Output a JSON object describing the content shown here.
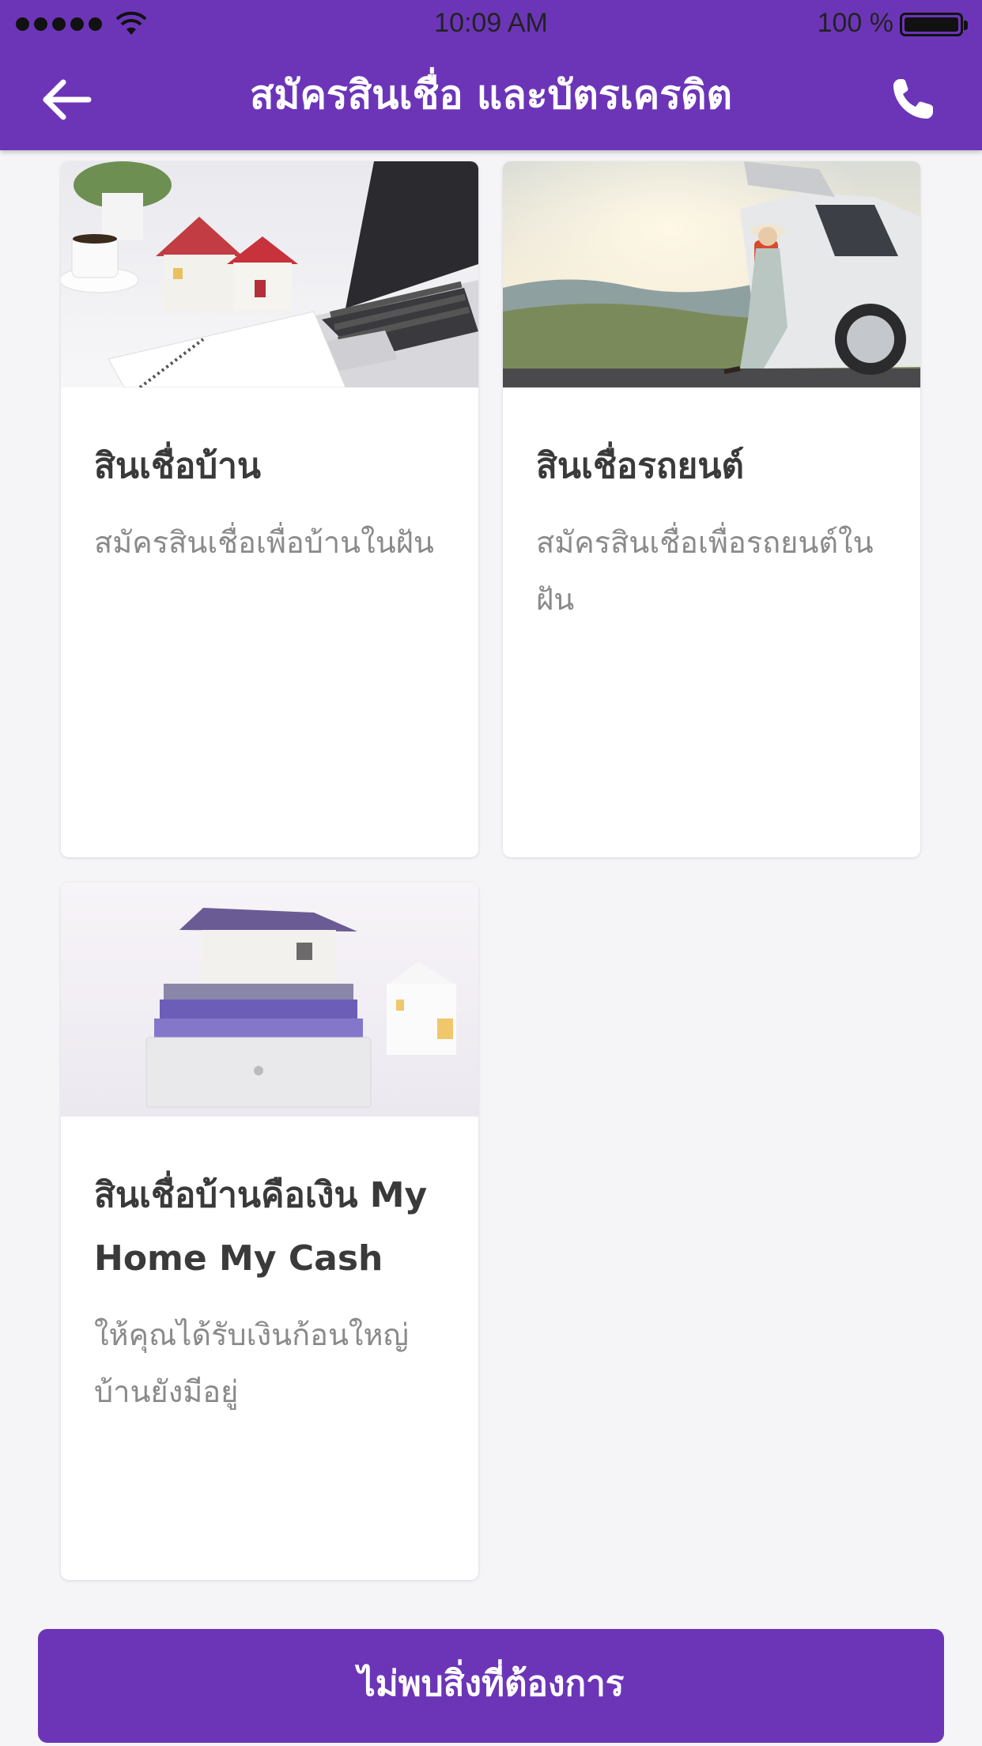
{
  "status_bar": {
    "time": "10:09 AM",
    "battery": "100 %"
  },
  "header": {
    "title": "สมัครสินเชื่อ และบัตรเครดิต",
    "back_icon": "arrow-left-icon",
    "call_icon": "phone-icon"
  },
  "cards": [
    {
      "title": "สินเชื่อบ้าน",
      "description": "สมัครสินเชื่อเพื่อบ้านในฝัน",
      "image": "home-loan-photo"
    },
    {
      "title": "สินเชื่อรถยนต์",
      "description": "สมัครสินเชื่อเพื่อรถยนต์ในฝัน",
      "image": "car-loan-photo"
    },
    {
      "title": "สินเชื่อบ้านคือเงิน My Home My Cash",
      "description": "ให้คุณได้รับเงินก้อนใหญ่ บ้านยังมีอยู่",
      "image": "home-cash-photo"
    }
  ],
  "cta": {
    "label": "ไม่พบสิ่งที่ต้องการ"
  },
  "colors": {
    "brand": "#6c35b8",
    "background": "#f5f5f8"
  }
}
